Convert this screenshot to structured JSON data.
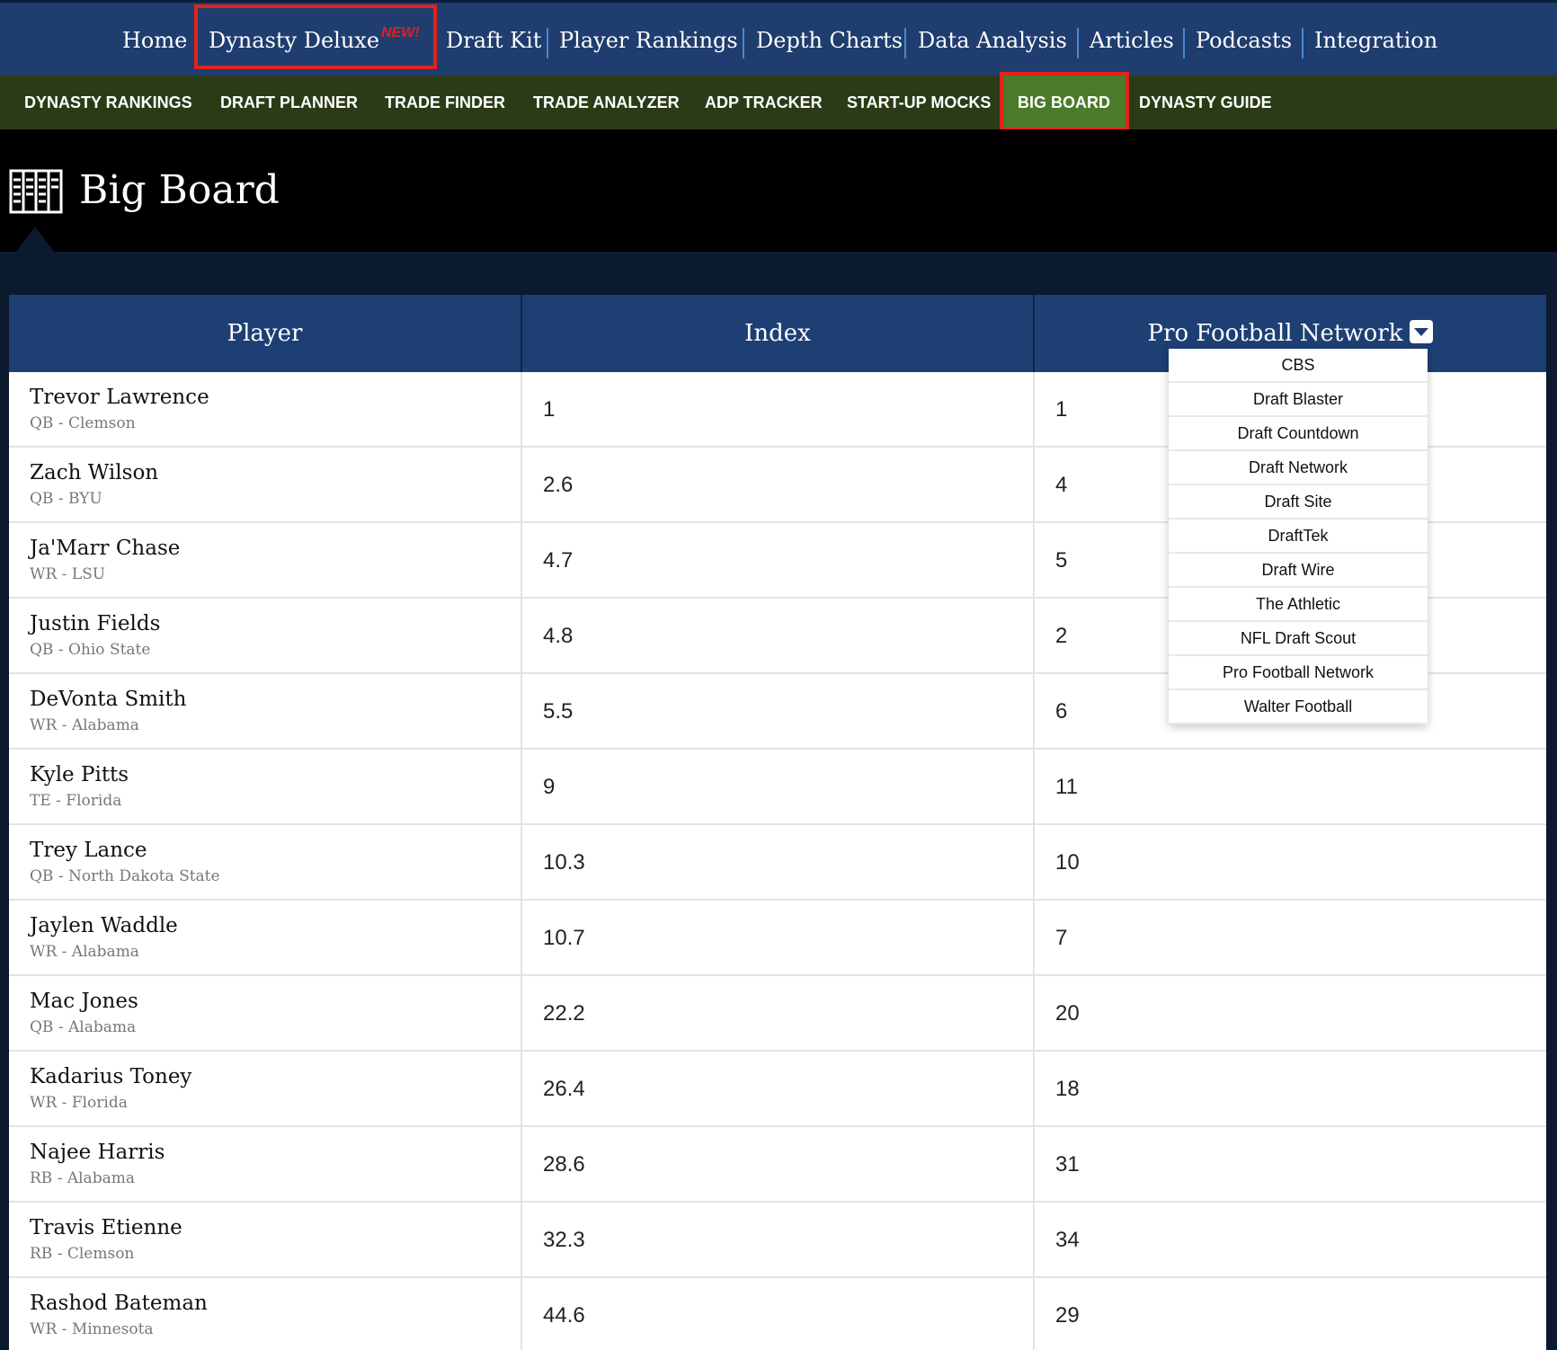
{
  "top_nav": {
    "items": [
      "Home",
      "Dynasty Deluxe",
      "Draft Kit",
      "Player Rankings",
      "Depth Charts",
      "Data Analysis",
      "Articles",
      "Podcasts",
      "Integration"
    ],
    "badge": "NEW!"
  },
  "sub_nav": {
    "items": [
      "DYNASTY RANKINGS",
      "DRAFT PLANNER",
      "TRADE FINDER",
      "TRADE ANALYZER",
      "ADP TRACKER",
      "START-UP MOCKS",
      "BIG BOARD",
      "DYNASTY GUIDE"
    ],
    "active": "BIG BOARD"
  },
  "page": {
    "title": "Big Board",
    "icon": "big-board-icon"
  },
  "table": {
    "columns": [
      "Player",
      "Index",
      "Pro Football Network"
    ],
    "rows": [
      {
        "name": "Trevor Lawrence",
        "info": "QB - Clemson",
        "index": "1",
        "rank": "1"
      },
      {
        "name": "Zach Wilson",
        "info": "QB - BYU",
        "index": "2.6",
        "rank": "4"
      },
      {
        "name": "Ja'Marr Chase",
        "info": "WR - LSU",
        "index": "4.7",
        "rank": "5"
      },
      {
        "name": "Justin Fields",
        "info": "QB - Ohio State",
        "index": "4.8",
        "rank": "2"
      },
      {
        "name": "DeVonta Smith",
        "info": "WR - Alabama",
        "index": "5.5",
        "rank": "6"
      },
      {
        "name": "Kyle Pitts",
        "info": "TE - Florida",
        "index": "9",
        "rank": "11"
      },
      {
        "name": "Trey Lance",
        "info": "QB - North Dakota State",
        "index": "10.3",
        "rank": "10"
      },
      {
        "name": "Jaylen Waddle",
        "info": "WR - Alabama",
        "index": "10.7",
        "rank": "7"
      },
      {
        "name": "Mac Jones",
        "info": "QB - Alabama",
        "index": "22.2",
        "rank": "20"
      },
      {
        "name": "Kadarius Toney",
        "info": "WR - Florida",
        "index": "26.4",
        "rank": "18"
      },
      {
        "name": "Najee Harris",
        "info": "RB - Alabama",
        "index": "28.6",
        "rank": "31"
      },
      {
        "name": "Travis Etienne",
        "info": "RB - Clemson",
        "index": "32.3",
        "rank": "34"
      },
      {
        "name": "Rashod Bateman",
        "info": "WR - Minnesota",
        "index": "44.6",
        "rank": "29"
      }
    ]
  },
  "source_dropdown": {
    "selected": "Pro Football Network",
    "options": [
      "CBS",
      "Draft Blaster",
      "Draft Countdown",
      "Draft Network",
      "Draft Site",
      "DraftTek",
      "Draft Wire",
      "The Athletic",
      "NFL Draft Scout",
      "Pro Football Network",
      "Walter Football"
    ]
  },
  "colors": {
    "top_nav_bg": "#1f3d6e",
    "sub_nav_bg": "#2a3c16",
    "sub_nav_active": "#4b7a2a",
    "table_header_bg": "#1e3f73",
    "highlight": "#e2221c"
  }
}
